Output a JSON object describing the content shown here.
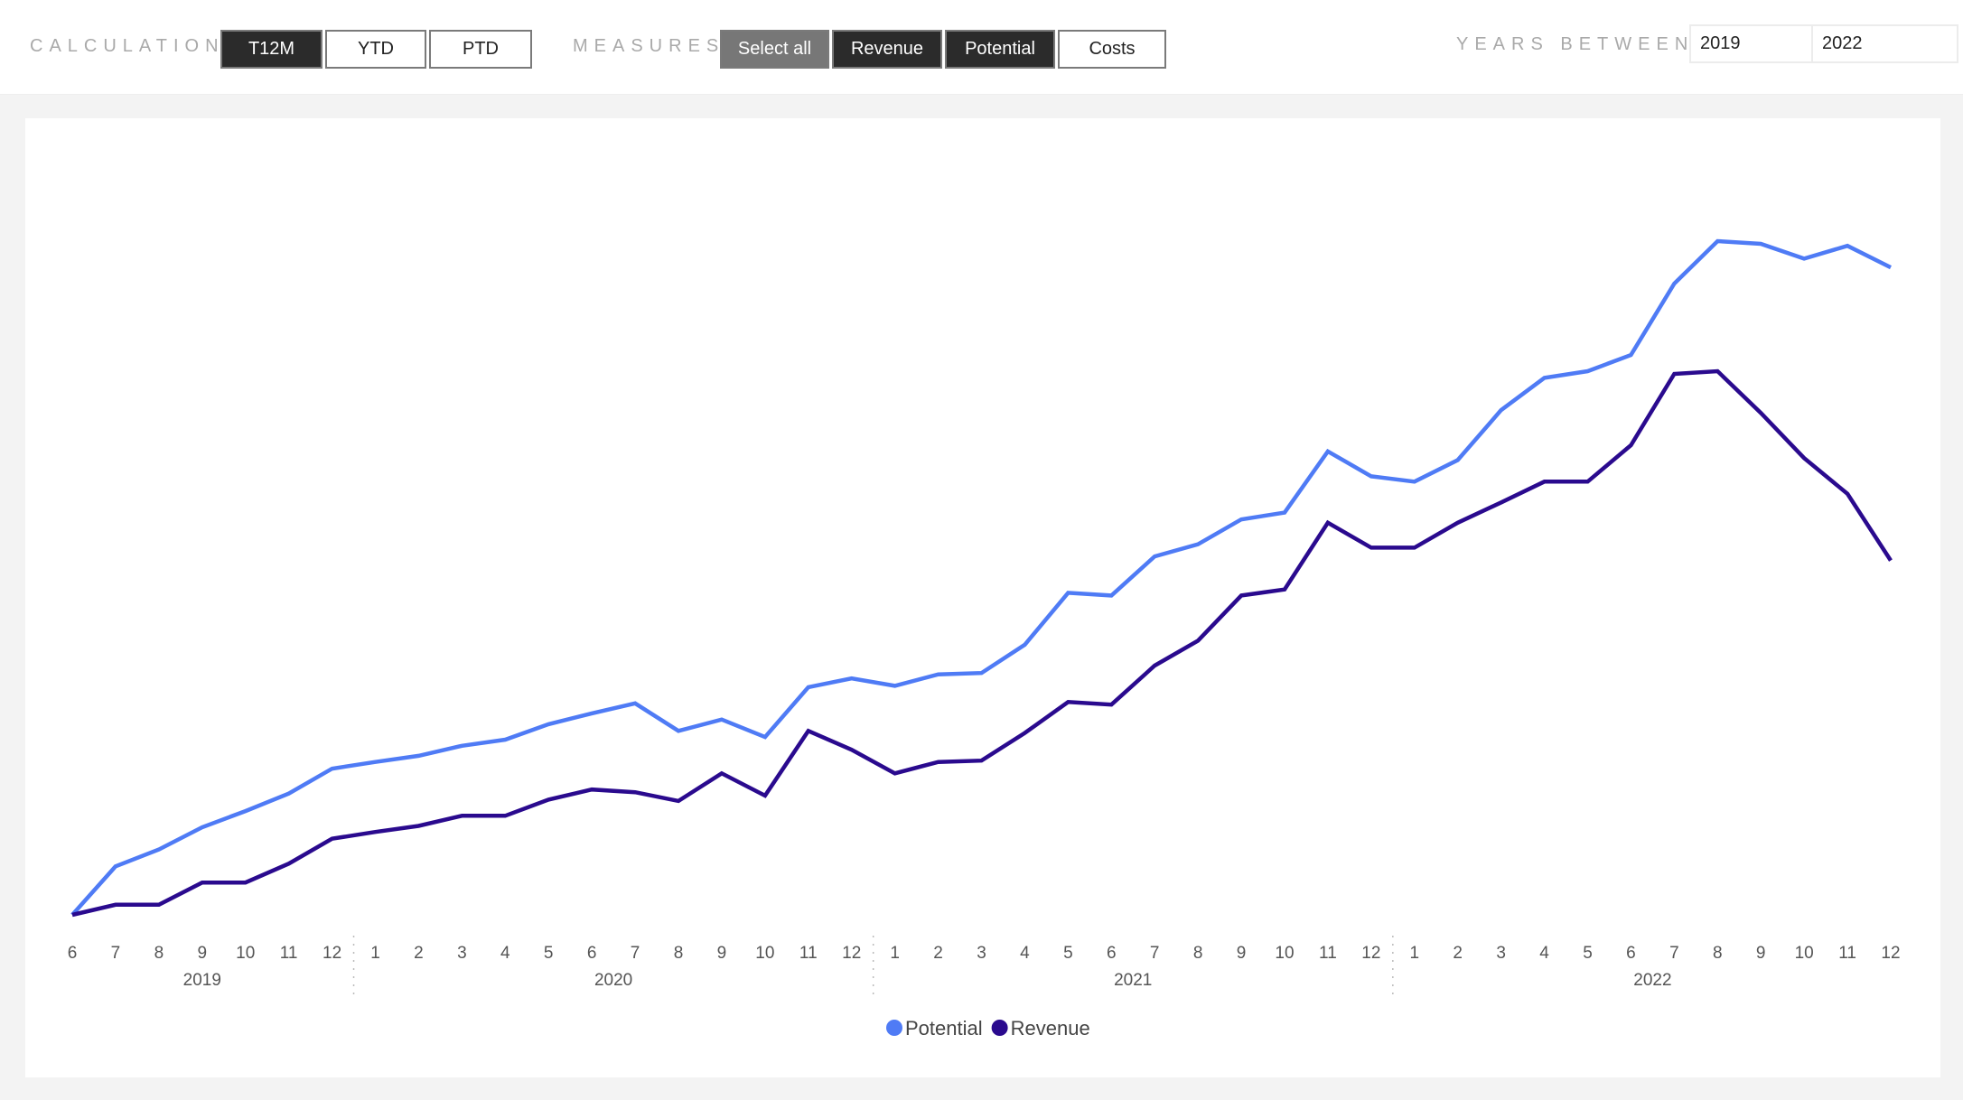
{
  "filters": {
    "calculation": {
      "label": "CALCULATION:",
      "options": [
        {
          "label": "T12M",
          "selected": true
        },
        {
          "label": "YTD",
          "selected": false
        },
        {
          "label": "PTD",
          "selected": false
        }
      ]
    },
    "measures": {
      "label": "MEASURES:",
      "options": [
        {
          "label": "Select all",
          "state": "partial"
        },
        {
          "label": "Revenue",
          "selected": true
        },
        {
          "label": "Potential",
          "selected": true
        },
        {
          "label": "Costs",
          "selected": false
        }
      ]
    },
    "years_between": {
      "label": "YEARS BETWEEN:",
      "from": "2019",
      "to": "2022"
    }
  },
  "colors": {
    "potential": "#4f7bf5",
    "revenue": "#2a0a8e",
    "selected_button": "#2b2b2b",
    "partial_button": "#777777"
  },
  "chart_data": {
    "type": "line",
    "title": "",
    "xlabel": "",
    "ylabel": "",
    "y_axis_visible": false,
    "value_units": "relative index (no y-axis shown; 0 = Jun 2019 level, 100 = max Potential)",
    "grid": false,
    "legend_position": "bottom-center",
    "x": [
      {
        "month": "6",
        "year": "2019"
      },
      {
        "month": "7",
        "year": "2019"
      },
      {
        "month": "8",
        "year": "2019"
      },
      {
        "month": "9",
        "year": "2019"
      },
      {
        "month": "10",
        "year": "2019"
      },
      {
        "month": "11",
        "year": "2019"
      },
      {
        "month": "12",
        "year": "2019"
      },
      {
        "month": "1",
        "year": "2020"
      },
      {
        "month": "2",
        "year": "2020"
      },
      {
        "month": "3",
        "year": "2020"
      },
      {
        "month": "4",
        "year": "2020"
      },
      {
        "month": "5",
        "year": "2020"
      },
      {
        "month": "6",
        "year": "2020"
      },
      {
        "month": "7",
        "year": "2020"
      },
      {
        "month": "8",
        "year": "2020"
      },
      {
        "month": "9",
        "year": "2020"
      },
      {
        "month": "10",
        "year": "2020"
      },
      {
        "month": "11",
        "year": "2020"
      },
      {
        "month": "12",
        "year": "2020"
      },
      {
        "month": "1",
        "year": "2021"
      },
      {
        "month": "2",
        "year": "2021"
      },
      {
        "month": "3",
        "year": "2021"
      },
      {
        "month": "4",
        "year": "2021"
      },
      {
        "month": "5",
        "year": "2021"
      },
      {
        "month": "6",
        "year": "2021"
      },
      {
        "month": "7",
        "year": "2021"
      },
      {
        "month": "8",
        "year": "2021"
      },
      {
        "month": "9",
        "year": "2021"
      },
      {
        "month": "10",
        "year": "2021"
      },
      {
        "month": "11",
        "year": "2021"
      },
      {
        "month": "12",
        "year": "2021"
      },
      {
        "month": "1",
        "year": "2022"
      },
      {
        "month": "2",
        "year": "2022"
      },
      {
        "month": "3",
        "year": "2022"
      },
      {
        "month": "4",
        "year": "2022"
      },
      {
        "month": "5",
        "year": "2022"
      },
      {
        "month": "6",
        "year": "2022"
      },
      {
        "month": "7",
        "year": "2022"
      },
      {
        "month": "8",
        "year": "2022"
      },
      {
        "month": "9",
        "year": "2022"
      },
      {
        "month": "10",
        "year": "2022"
      },
      {
        "month": "11",
        "year": "2022"
      },
      {
        "month": "12",
        "year": "2022"
      }
    ],
    "years": [
      "2019",
      "2020",
      "2021",
      "2022"
    ],
    "ylim": [
      0,
      100
    ],
    "series": [
      {
        "name": "Potential",
        "color": "#4f7bf5",
        "values": [
          0,
          7.2,
          9.7,
          13.0,
          15.4,
          18.0,
          21.7,
          22.7,
          23.6,
          25.1,
          26.0,
          28.3,
          29.9,
          31.4,
          27.3,
          29.0,
          26.4,
          33.8,
          35.1,
          34.0,
          35.7,
          35.9,
          40.1,
          47.8,
          47.4,
          53.2,
          55.0,
          58.7,
          59.7,
          68.8,
          65.1,
          64.3,
          67.5,
          74.9,
          79.7,
          80.7,
          83.1,
          93.7,
          100.0,
          99.6,
          97.4,
          99.3,
          96.1
        ]
      },
      {
        "name": "Revenue",
        "color": "#2a0a8e",
        "values": [
          0,
          1.5,
          1.5,
          4.8,
          4.8,
          7.6,
          11.3,
          12.3,
          13.2,
          14.7,
          14.7,
          17.1,
          18.6,
          18.2,
          16.9,
          21.0,
          17.7,
          27.3,
          24.5,
          21.0,
          22.7,
          22.9,
          27.0,
          31.6,
          31.2,
          37.0,
          40.7,
          47.4,
          48.3,
          58.2,
          54.5,
          54.5,
          58.2,
          61.2,
          64.3,
          64.3,
          69.7,
          80.3,
          80.7,
          74.5,
          67.8,
          62.5,
          52.6
        ]
      }
    ]
  }
}
